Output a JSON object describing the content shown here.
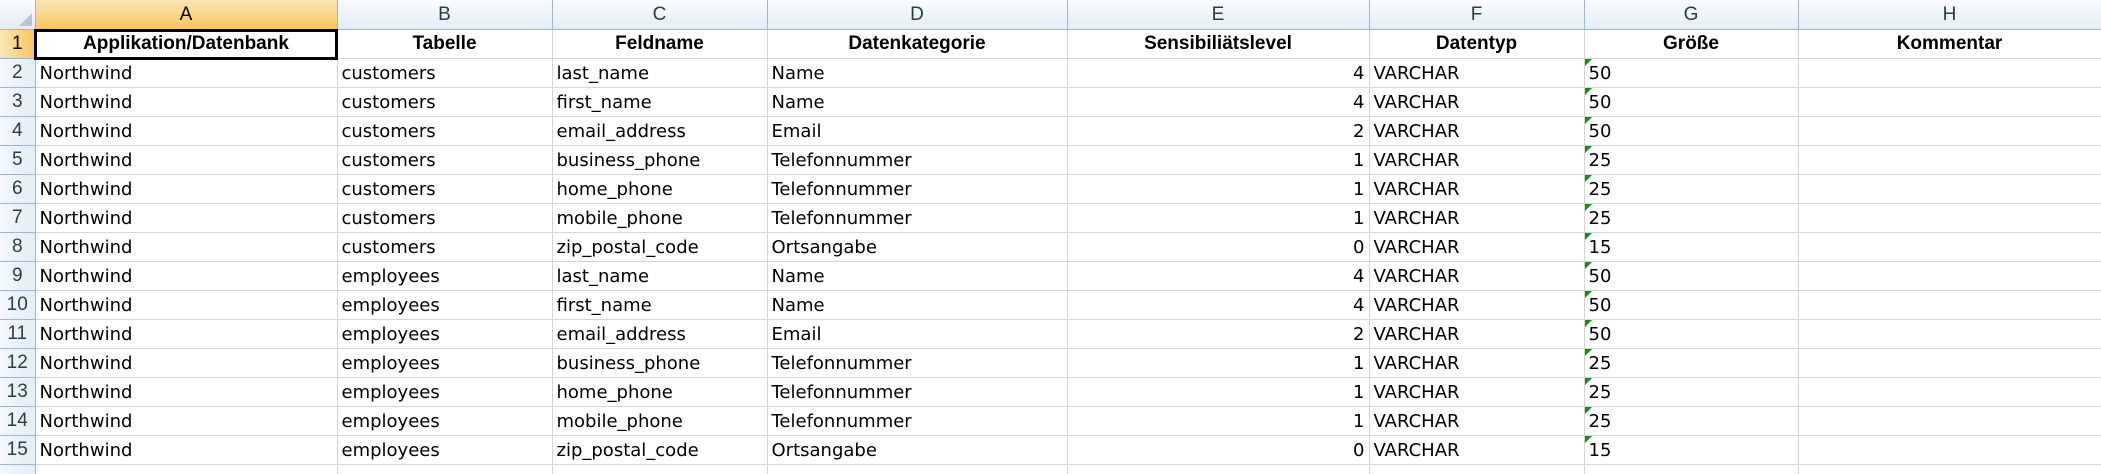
{
  "column_letters": [
    "A",
    "B",
    "C",
    "D",
    "E",
    "F",
    "G",
    "H"
  ],
  "active_column": "A",
  "header_row": {
    "row_number": "1",
    "cells": [
      "Applikation/Datenbank",
      "Tabelle",
      "Feldname",
      "Datenkategorie",
      "Sensibiliätslevel",
      "Datentyp",
      "Größe",
      "Kommentar"
    ]
  },
  "rows": [
    {
      "row_number": "2",
      "cells": [
        "Northwind",
        "customers",
        "last_name",
        "Name",
        "4",
        "VARCHAR",
        "50",
        ""
      ]
    },
    {
      "row_number": "3",
      "cells": [
        "Northwind",
        "customers",
        "first_name",
        "Name",
        "4",
        "VARCHAR",
        "50",
        ""
      ]
    },
    {
      "row_number": "4",
      "cells": [
        "Northwind",
        "customers",
        "email_address",
        "Email",
        "2",
        "VARCHAR",
        "50",
        ""
      ]
    },
    {
      "row_number": "5",
      "cells": [
        "Northwind",
        "customers",
        "business_phone",
        "Telefonnummer",
        "1",
        "VARCHAR",
        "25",
        ""
      ]
    },
    {
      "row_number": "6",
      "cells": [
        "Northwind",
        "customers",
        "home_phone",
        "Telefonnummer",
        "1",
        "VARCHAR",
        "25",
        ""
      ]
    },
    {
      "row_number": "7",
      "cells": [
        "Northwind",
        "customers",
        "mobile_phone",
        "Telefonnummer",
        "1",
        "VARCHAR",
        "25",
        ""
      ]
    },
    {
      "row_number": "8",
      "cells": [
        "Northwind",
        "customers",
        "zip_postal_code",
        "Ortsangabe",
        "0",
        "VARCHAR",
        "15",
        ""
      ]
    },
    {
      "row_number": "9",
      "cells": [
        "Northwind",
        "employees",
        "last_name",
        "Name",
        "4",
        "VARCHAR",
        "50",
        ""
      ]
    },
    {
      "row_number": "10",
      "cells": [
        "Northwind",
        "employees",
        "first_name",
        "Name",
        "4",
        "VARCHAR",
        "50",
        ""
      ]
    },
    {
      "row_number": "11",
      "cells": [
        "Northwind",
        "employees",
        "email_address",
        "Email",
        "2",
        "VARCHAR",
        "50",
        ""
      ]
    },
    {
      "row_number": "12",
      "cells": [
        "Northwind",
        "employees",
        "business_phone",
        "Telefonnummer",
        "1",
        "VARCHAR",
        "25",
        ""
      ]
    },
    {
      "row_number": "13",
      "cells": [
        "Northwind",
        "employees",
        "home_phone",
        "Telefonnummer",
        "1",
        "VARCHAR",
        "25",
        ""
      ]
    },
    {
      "row_number": "14",
      "cells": [
        "Northwind",
        "employees",
        "mobile_phone",
        "Telefonnummer",
        "1",
        "VARCHAR",
        "25",
        ""
      ]
    },
    {
      "row_number": "15",
      "cells": [
        "Northwind",
        "employees",
        "zip_postal_code",
        "Ortsangabe",
        "0",
        "VARCHAR",
        "15",
        ""
      ]
    }
  ],
  "colors": {
    "header_bg": "#e4ecf7",
    "active_header_bg": "#f6c65f",
    "gridline": "#d4d4d4",
    "text_number_indicator": "#1a8a1a"
  }
}
